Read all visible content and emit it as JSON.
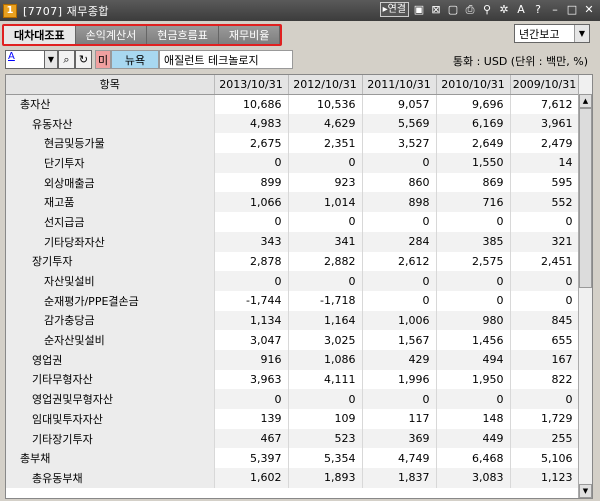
{
  "window": {
    "number": "1",
    "title": "[7707] 재무종합",
    "link_label": "▸연결"
  },
  "tabs": [
    "대차대조표",
    "손익계산서",
    "현금흐름표",
    "재무비율"
  ],
  "period_select": {
    "value": "년간보고"
  },
  "search": {
    "code": "A",
    "market": "미",
    "exchange": "뉴욕",
    "company": "애질런트 테크놀로지",
    "unit_text": "통화 : USD (단위 : 백만, %)"
  },
  "table": {
    "headers": [
      "항목",
      "2013/10/31",
      "2012/10/31",
      "2011/10/31",
      "2010/10/31",
      "2009/10/31"
    ],
    "rows": [
      {
        "label": "총자산",
        "level": 1,
        "values": [
          "10,686",
          "10,536",
          "9,057",
          "9,696",
          "7,612"
        ]
      },
      {
        "label": "유동자산",
        "level": 2,
        "values": [
          "4,983",
          "4,629",
          "5,569",
          "6,169",
          "3,961"
        ]
      },
      {
        "label": "현금및등가물",
        "level": 3,
        "values": [
          "2,675",
          "2,351",
          "3,527",
          "2,649",
          "2,479"
        ]
      },
      {
        "label": "단기투자",
        "level": 3,
        "values": [
          "0",
          "0",
          "0",
          "1,550",
          "14"
        ]
      },
      {
        "label": "외상매출금",
        "level": 3,
        "values": [
          "899",
          "923",
          "860",
          "869",
          "595"
        ]
      },
      {
        "label": "재고품",
        "level": 3,
        "values": [
          "1,066",
          "1,014",
          "898",
          "716",
          "552"
        ]
      },
      {
        "label": "선지급금",
        "level": 3,
        "values": [
          "0",
          "0",
          "0",
          "0",
          "0"
        ]
      },
      {
        "label": "기타당좌자산",
        "level": 3,
        "values": [
          "343",
          "341",
          "284",
          "385",
          "321"
        ]
      },
      {
        "label": "장기투자",
        "level": 2,
        "values": [
          "2,878",
          "2,882",
          "2,612",
          "2,575",
          "2,451"
        ]
      },
      {
        "label": "자산및설비",
        "level": 3,
        "values": [
          "0",
          "0",
          "0",
          "0",
          "0"
        ]
      },
      {
        "label": "순재평가/PPE결손금",
        "level": 3,
        "values": [
          "-1,744",
          "-1,718",
          "0",
          "0",
          "0"
        ]
      },
      {
        "label": "감가충당금",
        "level": 3,
        "values": [
          "1,134",
          "1,164",
          "1,006",
          "980",
          "845"
        ]
      },
      {
        "label": "순자산및설비",
        "level": 3,
        "values": [
          "3,047",
          "3,025",
          "1,567",
          "1,456",
          "655"
        ]
      },
      {
        "label": "영업권",
        "level": 2,
        "values": [
          "916",
          "1,086",
          "429",
          "494",
          "167"
        ]
      },
      {
        "label": "기타무형자산",
        "level": 2,
        "values": [
          "3,963",
          "4,111",
          "1,996",
          "1,950",
          "822"
        ]
      },
      {
        "label": "영업권및무형자산",
        "level": 2,
        "values": [
          "0",
          "0",
          "0",
          "0",
          "0"
        ]
      },
      {
        "label": "임대및투자자산",
        "level": 2,
        "values": [
          "139",
          "109",
          "117",
          "148",
          "1,729"
        ]
      },
      {
        "label": "기타장기투자",
        "level": 2,
        "values": [
          "467",
          "523",
          "369",
          "449",
          "255"
        ]
      },
      {
        "label": "총부채",
        "level": 1,
        "values": [
          "5,397",
          "5,354",
          "4,749",
          "6,468",
          "5,106"
        ]
      },
      {
        "label": "총유동부채",
        "level": 2,
        "values": [
          "1,602",
          "1,893",
          "1,837",
          "3,083",
          "1,123"
        ]
      }
    ]
  }
}
